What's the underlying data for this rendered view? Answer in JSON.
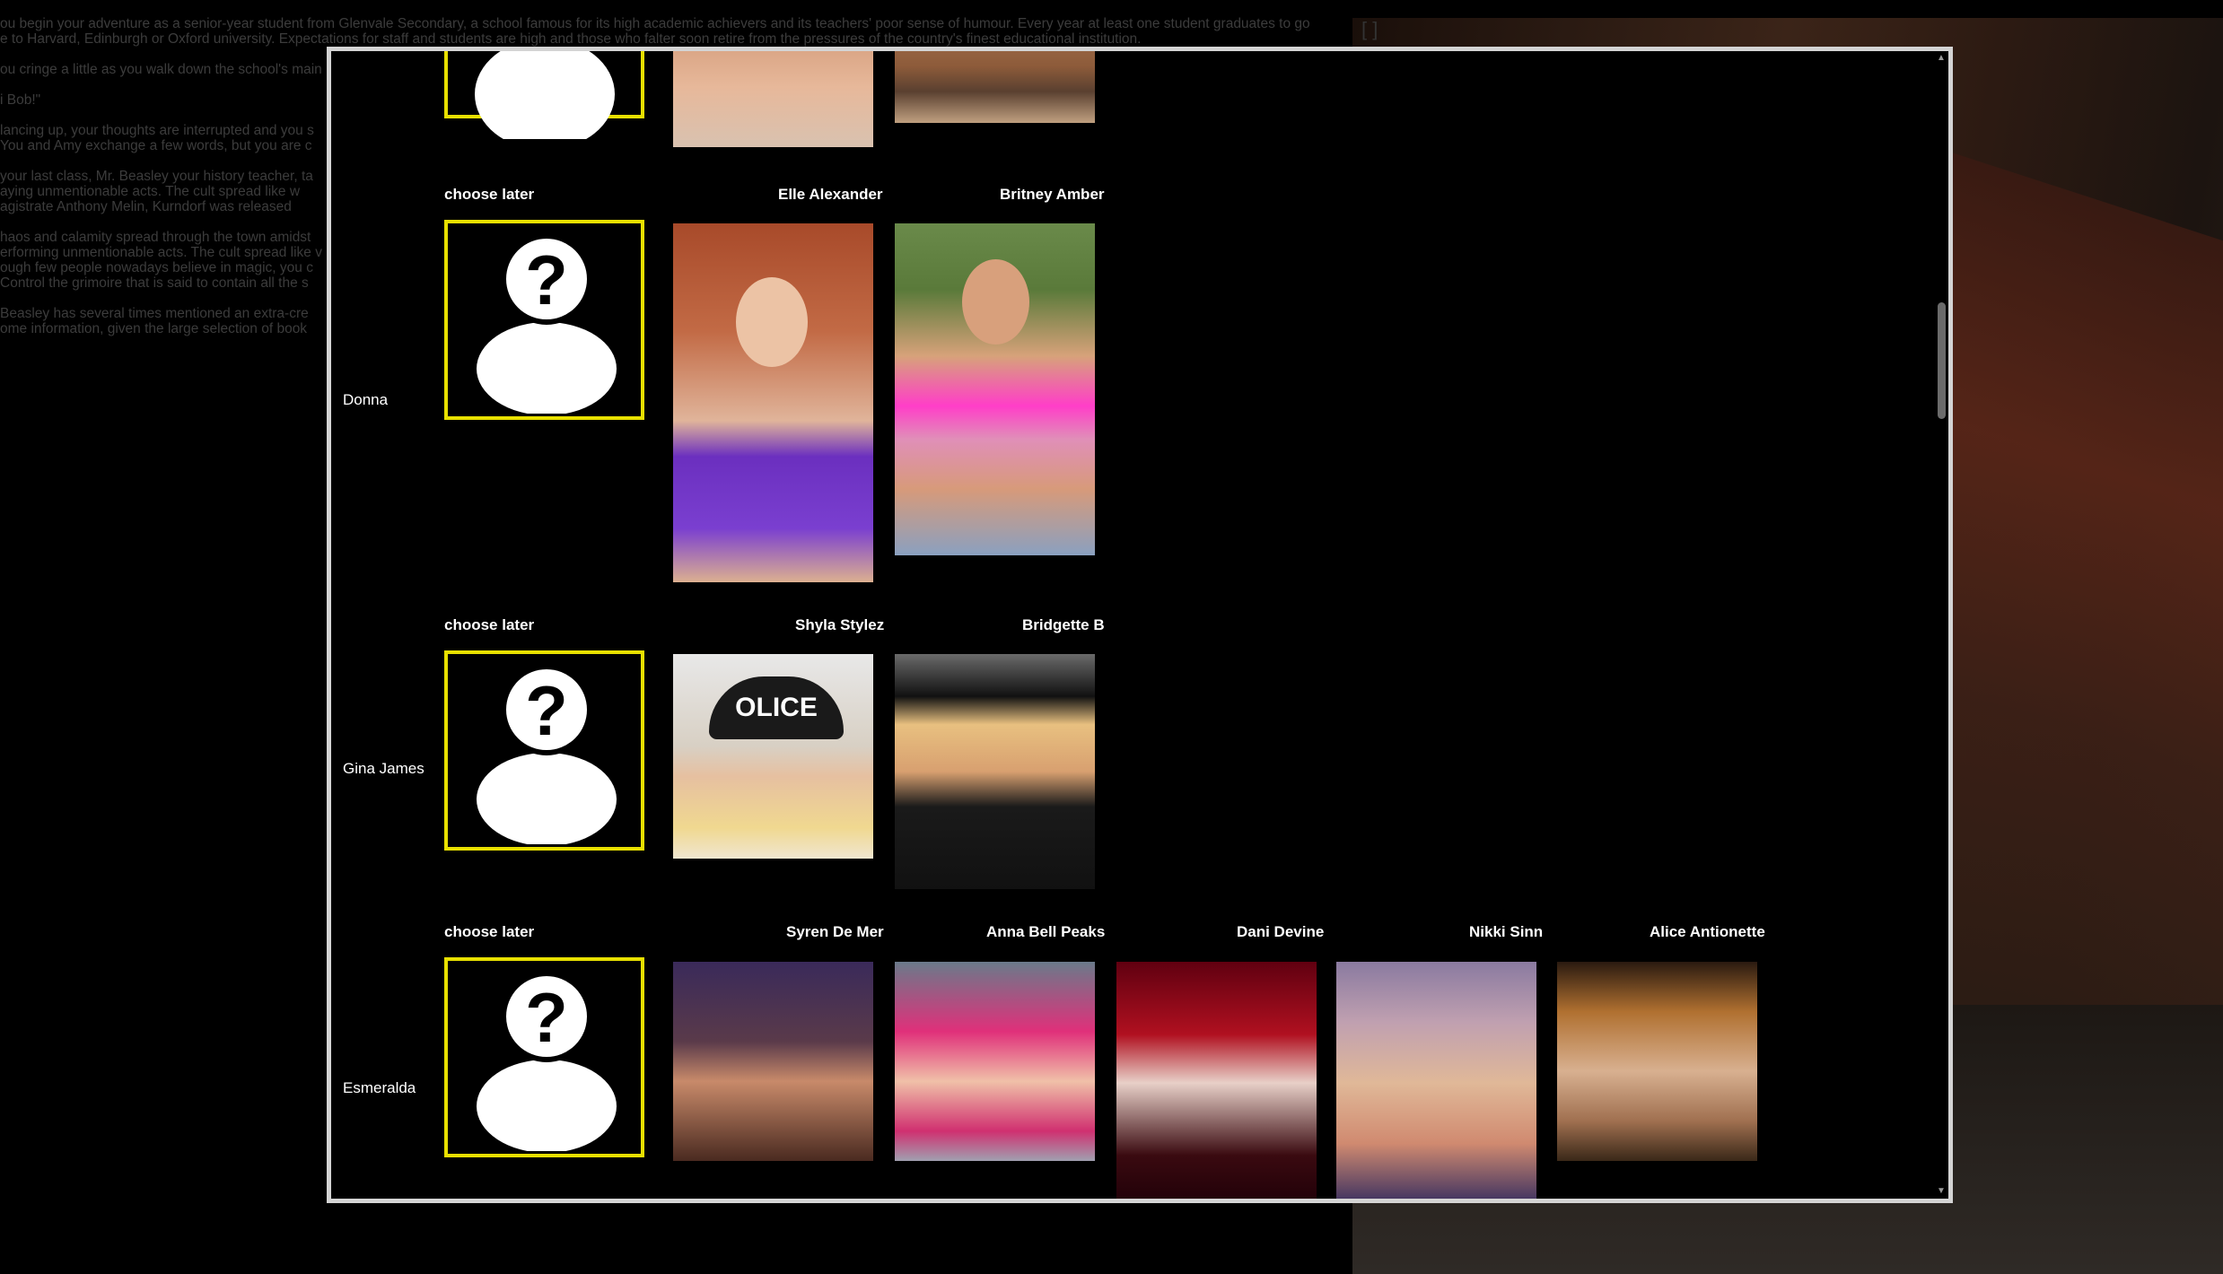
{
  "background": {
    "story_lines": [
      "ou begin your adventure as a senior-year student from Glenvale Secondary, a school famous for its high academic achievers and its teachers' poor sense of humour. Every year at least one student graduates to go",
      "e to Harvard, Edinburgh or Oxford university. Expectations for staff and students are high and those who falter soon retire from the pressures of the country's finest educational institution.",
      "ou cringe a little as you walk down the school's main",
      "i Bob!\"",
      "lancing up, your thoughts are interrupted and you s",
      "You and Amy exchange a few words, but you are c",
      "your last class, Mr. Beasley your history teacher, ta",
      "aying unmentionable acts. The cult spread like w",
      "agistrate Anthony Melin, Kurndorf was released",
      "haos and calamity spread through the town amidst",
      "erforming unmentionable acts. The cult spread like v",
      "ough few people nowadays believe in magic, you c",
      "Control the grimoire that is said to contain all the s",
      "Beasley has several times mentioned an extra-cre",
      "ome information, given the large selection of book"
    ],
    "corner_hint": "[ ]"
  },
  "modal": {
    "top_row": {
      "choose_label": "",
      "photos": [
        "top-photo-1",
        "top-photo-2"
      ]
    },
    "rows": [
      {
        "character": "Donna",
        "choose_label": "choose later",
        "options": [
          "Elle Alexander",
          "Britney Amber"
        ]
      },
      {
        "character": "Gina James",
        "choose_label": "choose later",
        "options": [
          "Shyla Stylez",
          "Bridgette B"
        ]
      },
      {
        "character": "Esmeralda",
        "choose_label": "choose later",
        "options": [
          "Syren De Mer",
          "Anna Bell Peaks",
          "Dani Devine",
          "Nikki Sinn",
          "Alice Antionette"
        ]
      }
    ]
  },
  "colors": {
    "selection_border": "#e8e000",
    "modal_border": "#d4d4d4",
    "background": "#000000"
  }
}
